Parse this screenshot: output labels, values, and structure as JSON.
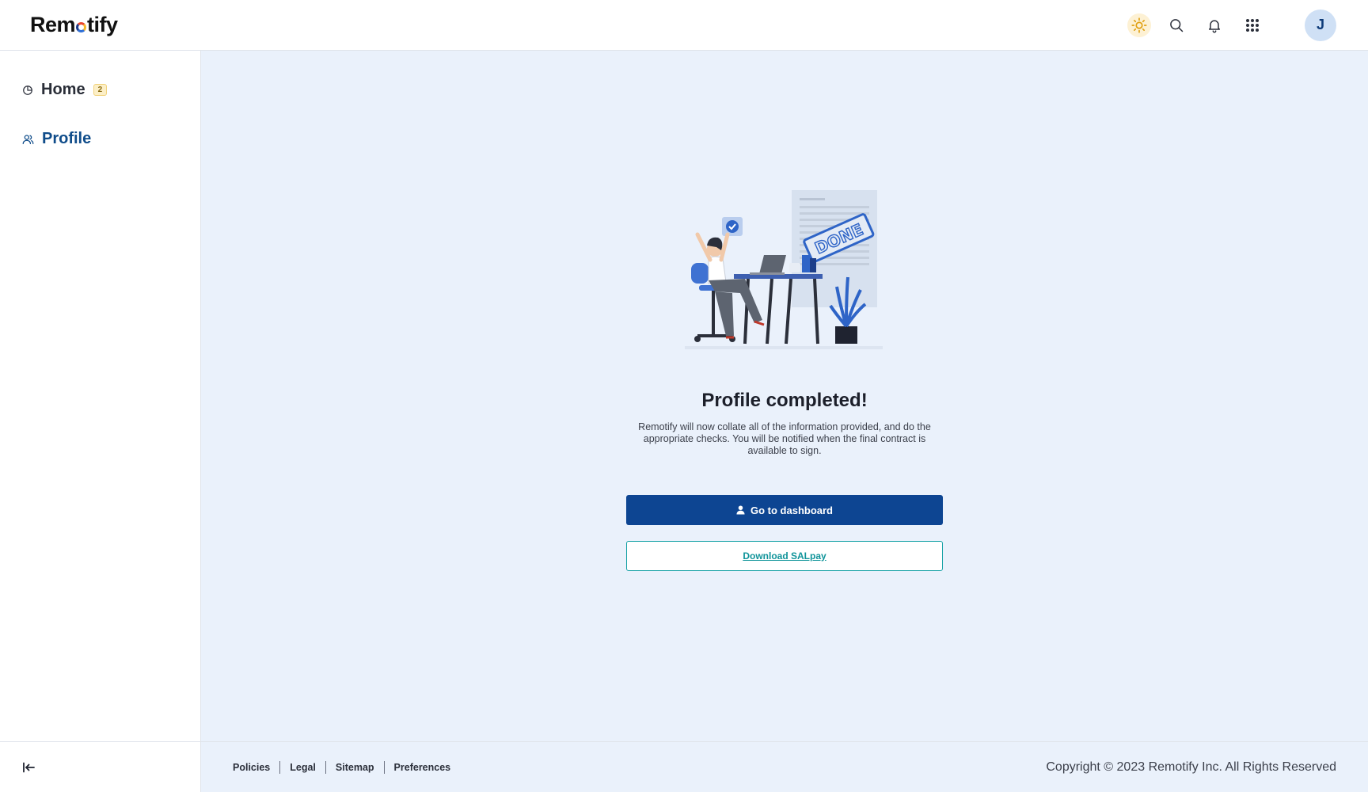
{
  "header": {
    "logo_prefix": "Rem",
    "logo_suffix": "tify",
    "avatar_initial": "J"
  },
  "sidebar": {
    "items": [
      {
        "label": "Home",
        "badge": "2",
        "icon": "pie-chart-icon"
      },
      {
        "label": "Profile",
        "icon": "users-icon",
        "active": true
      }
    ]
  },
  "main": {
    "illustration_stamp": "DONE",
    "title": "Profile completed!",
    "description": "Remotify will now collate all of the information provided, and do the appropriate checks. You will be notified when the final contract is available to sign.",
    "primary_button": "Go to dashboard",
    "secondary_button": "Download SALpay"
  },
  "footer": {
    "links": [
      "Policies",
      "Legal",
      "Sitemap",
      "Preferences"
    ],
    "copyright": "Copyright © 2023 Remotify Inc. All Rights Reserved"
  },
  "colors": {
    "primary": "#0d4592",
    "accent_teal": "#17a2a6",
    "main_bg": "#eaf1fb",
    "active_nav": "#0f4c8a"
  }
}
